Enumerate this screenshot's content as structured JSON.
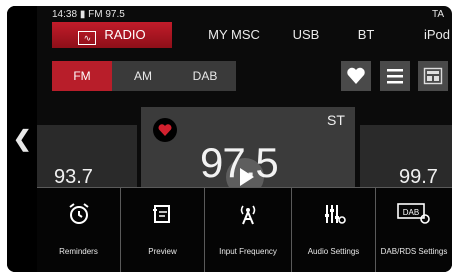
{
  "status": {
    "time": "14:38",
    "station": "FM 97.5",
    "ta": "TA"
  },
  "nav": {
    "tabs": [
      "RADIO",
      "MY MSC",
      "USB",
      "BT",
      "iPod"
    ],
    "active": "RADIO"
  },
  "band": {
    "options": [
      "FM",
      "AM",
      "DAB"
    ],
    "selected": "FM"
  },
  "tools": [
    "heart-icon",
    "list-icon",
    "station-list-icon"
  ],
  "tuner": {
    "prev_freq": "93.7",
    "current_freq": "97.5",
    "next_freq": "99.7",
    "stereo": "ST",
    "favorite": true
  },
  "menu": {
    "items": [
      {
        "label": "Reminders",
        "icon": "alarm-icon"
      },
      {
        "label": "Preview",
        "icon": "preview-icon"
      },
      {
        "label": "Input Frequency",
        "icon": "antenna-icon"
      },
      {
        "label": "Audio Settings",
        "icon": "equalizer-icon"
      },
      {
        "label": "DAB/RDS Settings",
        "icon": "dab-settings-icon"
      }
    ]
  },
  "colors": {
    "accent": "#b81e2a",
    "background": "#0b0b0b",
    "panel": "#3b3b3b"
  }
}
